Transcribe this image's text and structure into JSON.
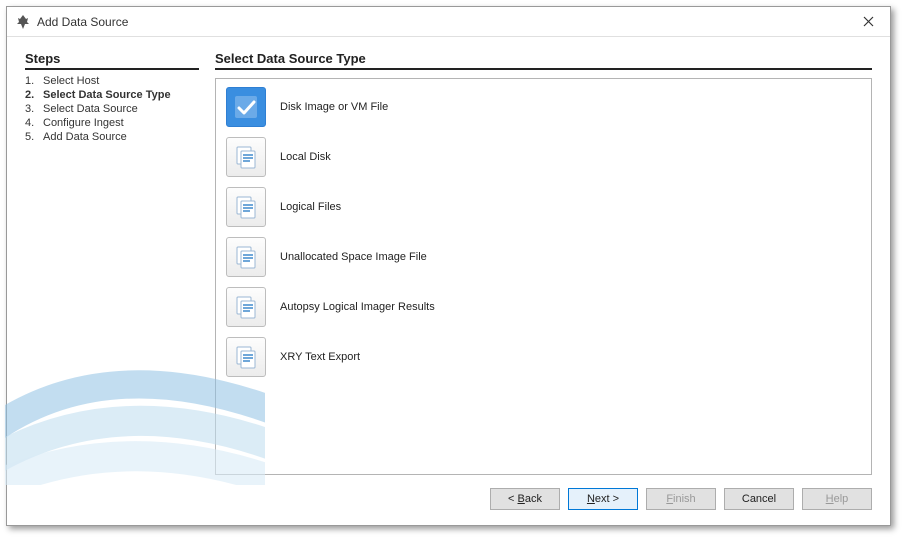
{
  "titlebar": {
    "title": "Add Data Source"
  },
  "sidebar": {
    "heading": "Steps",
    "steps": [
      {
        "num": "1.",
        "label": "Select Host",
        "current": false
      },
      {
        "num": "2.",
        "label": "Select Data Source Type",
        "current": true
      },
      {
        "num": "3.",
        "label": "Select Data Source",
        "current": false
      },
      {
        "num": "4.",
        "label": "Configure Ingest",
        "current": false
      },
      {
        "num": "5.",
        "label": "Add Data Source",
        "current": false
      }
    ]
  },
  "main": {
    "heading": "Select Data Source Type",
    "options": [
      {
        "id": "disk-image",
        "label": "Disk Image or VM File",
        "selected": true,
        "icon": "checkmark-icon"
      },
      {
        "id": "local-disk",
        "label": "Local Disk",
        "selected": false,
        "icon": "files-icon"
      },
      {
        "id": "logical-files",
        "label": "Logical Files",
        "selected": false,
        "icon": "files-icon"
      },
      {
        "id": "unallocated",
        "label": "Unallocated Space Image File",
        "selected": false,
        "icon": "files-icon"
      },
      {
        "id": "autopsy-imager",
        "label": "Autopsy Logical Imager Results",
        "selected": false,
        "icon": "files-icon"
      },
      {
        "id": "xry",
        "label": "XRY Text Export",
        "selected": false,
        "icon": "files-icon"
      }
    ]
  },
  "footer": {
    "back": "< Back",
    "next": "Next >",
    "finish": "Finish",
    "cancel": "Cancel",
    "help": "Help"
  }
}
